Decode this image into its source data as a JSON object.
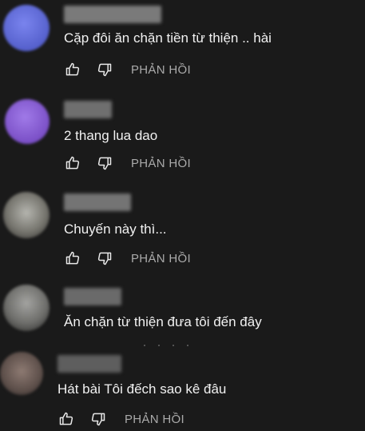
{
  "comments": [
    {
      "text": "Cặp đôi ăn chặn tiền từ thiện .. hài",
      "reply_label": "PHẢN HỒI",
      "avatar_color": "#5f6ad8",
      "author_color": "#7a7a7a"
    },
    {
      "text": "2 thang lua dao",
      "reply_label": "PHẢN HỒI",
      "avatar_color": "#8b5fd3",
      "author_color": "#6f6f6f"
    },
    {
      "text": "Chuyến này thì...",
      "reply_label": "PHẢN HỒI",
      "avatar_color": "#8a8a86",
      "author_color": "#747474"
    },
    {
      "text": "Ăn chặn từ thiện đưa tôi đến đây",
      "reply_label": "",
      "avatar_color": "#7c7c7a",
      "author_color": "#6a6a6a"
    },
    {
      "text": "Hát bài Tôi đếch sao kê đâu",
      "reply_label": "PHẢN HỒI",
      "avatar_color": "#6b5a55",
      "author_color": "#5e5e5e"
    }
  ],
  "icons": {
    "like": "thumbs-up-icon",
    "dislike": "thumbs-down-icon"
  }
}
